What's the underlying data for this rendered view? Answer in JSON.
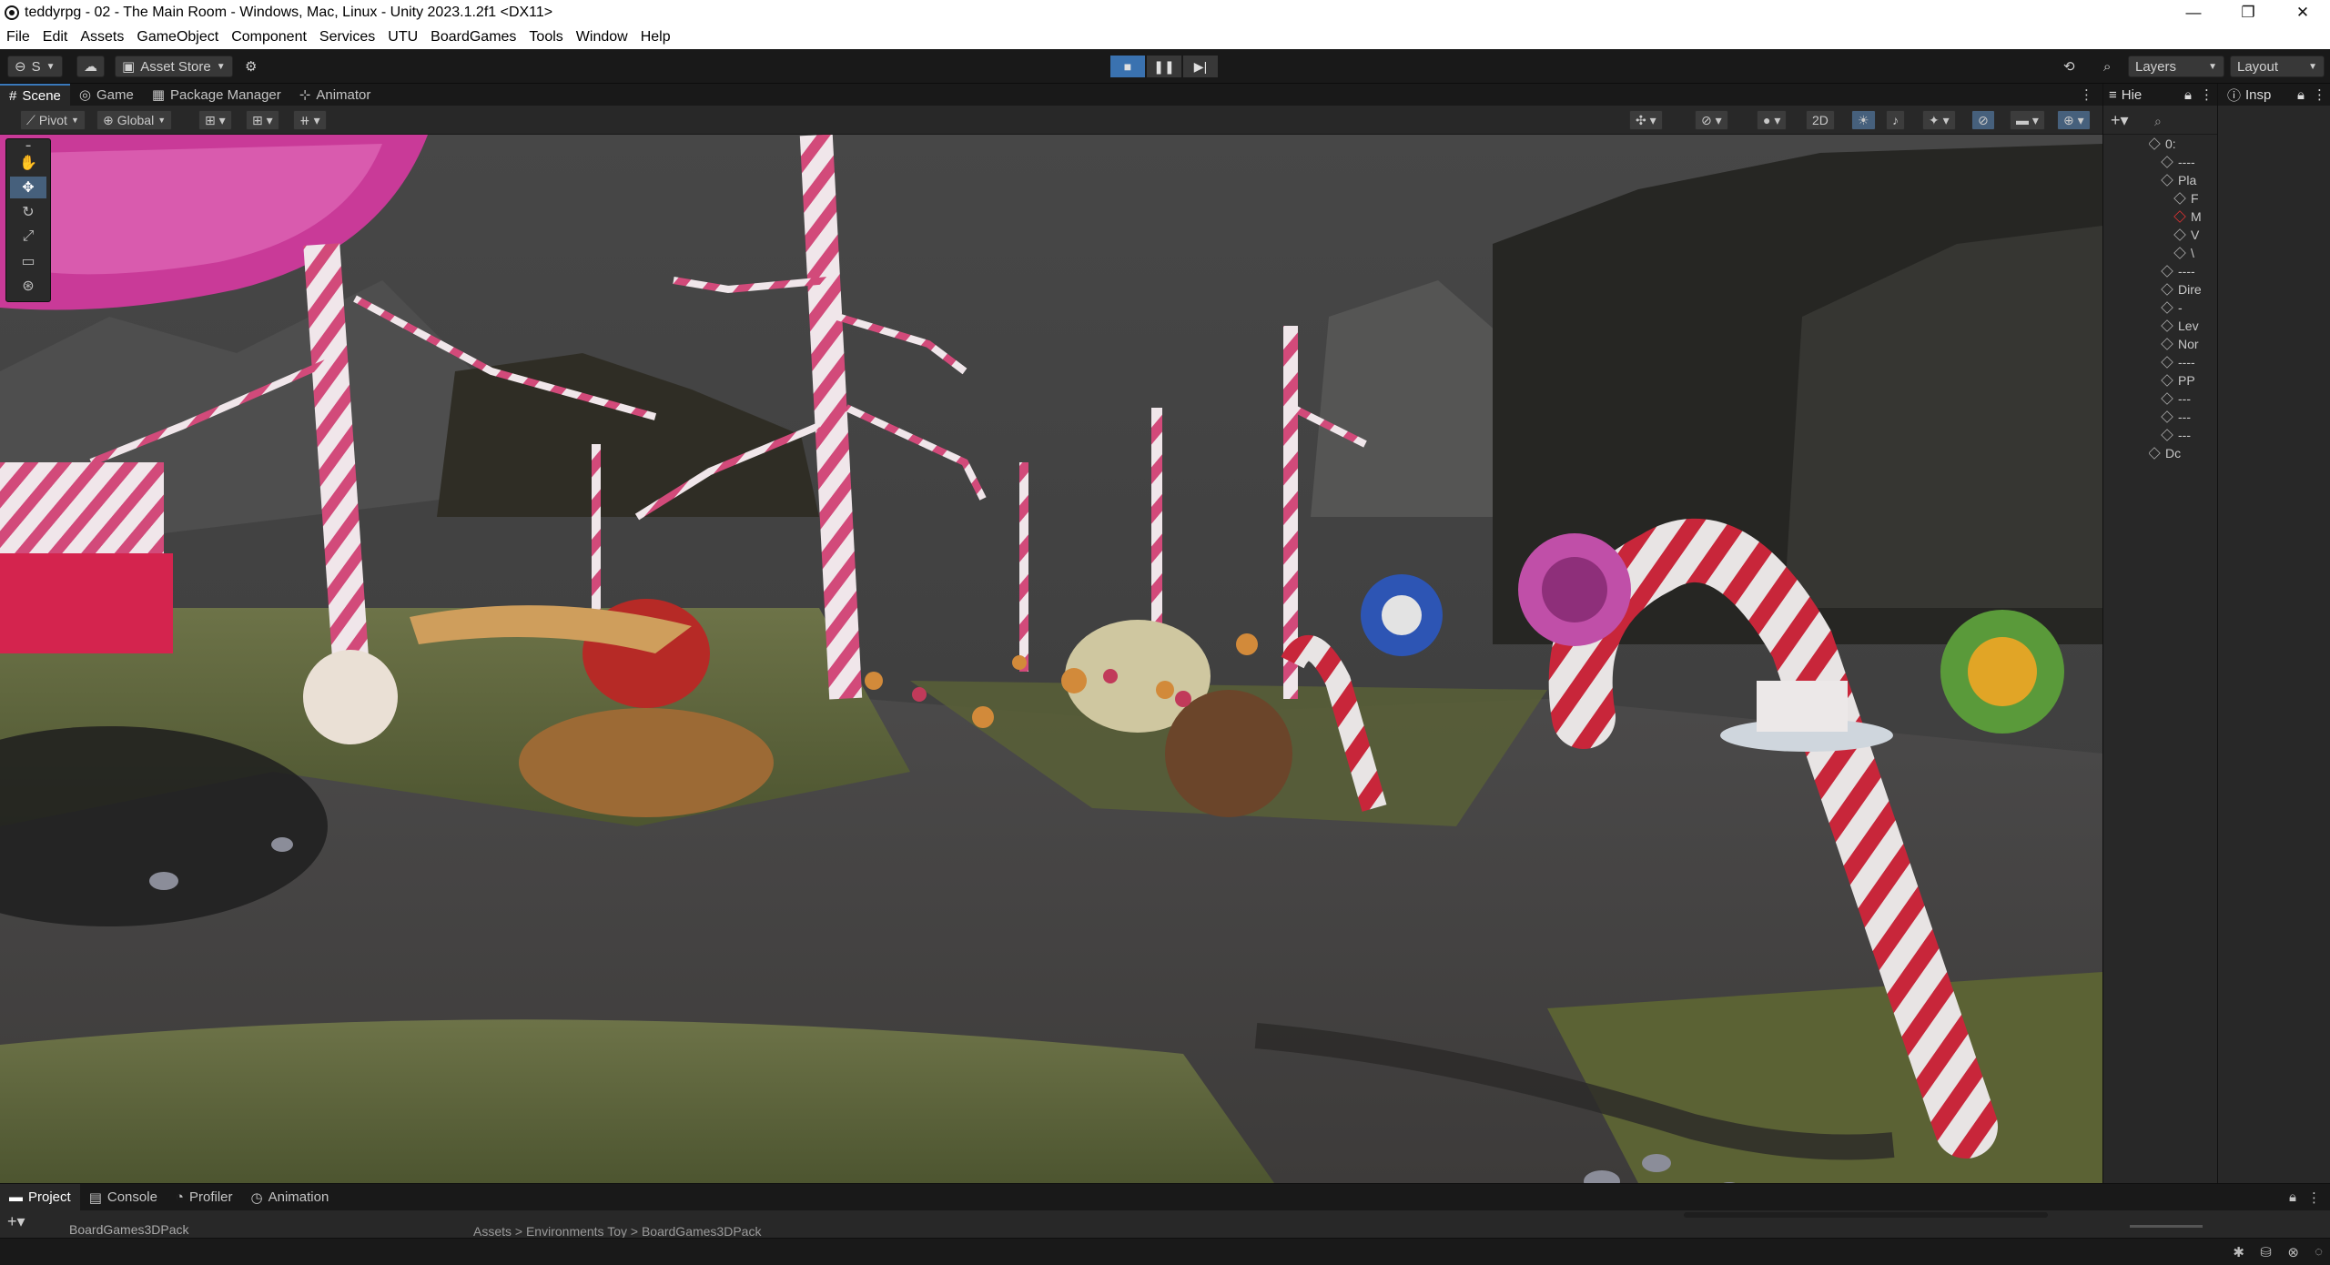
{
  "window": {
    "title": "teddyrpg - 02 - The Main Room - Windows, Mac, Linux - Unity 2023.1.2f1 <DX11>",
    "minimize": "—",
    "maximize": "❐",
    "close": "✕"
  },
  "menu": [
    "File",
    "Edit",
    "Assets",
    "GameObject",
    "Component",
    "Services",
    "UTU",
    "BoardGames",
    "Tools",
    "Window",
    "Help"
  ],
  "toolbar": {
    "account_label": "S",
    "asset_store_label": "Asset Store",
    "layers_label": "Layers",
    "layout_label": "Layout"
  },
  "tabs": [
    {
      "label": "Scene",
      "icon": "grid-icon"
    },
    {
      "label": "Game",
      "icon": "gamepad-icon"
    },
    {
      "label": "Package Manager",
      "icon": "package-icon"
    },
    {
      "label": "Animator",
      "icon": "animator-icon"
    }
  ],
  "scene_toolbar": {
    "pivot_label": "Pivot",
    "global_label": "Global",
    "mode_2d_label": "2D"
  },
  "hierarchy": {
    "tab_label": "Hie",
    "rows": [
      "0:",
      "----",
      "Pla",
      "F",
      "M",
      "V",
      "\\",
      "----",
      "Dire",
      "-",
      "Lev",
      "Nor",
      "----",
      "PP",
      "---",
      "---",
      "---",
      "Dc"
    ]
  },
  "inspector": {
    "tab_label": "Insp"
  },
  "bottom_tabs": [
    {
      "label": "Project",
      "icon": "folder-icon"
    },
    {
      "label": "Console",
      "icon": "console-icon"
    },
    {
      "label": "Profiler",
      "icon": "profiler-icon"
    },
    {
      "label": "Animation",
      "icon": "clock-icon"
    }
  ],
  "project": {
    "folder_label": "BoardGames3DPack",
    "breadcrumb": "Assets > Environments Toy > BoardGames3DPack"
  },
  "colors": {
    "play_active": "#3a72b0",
    "tab_highlight": "#3a79bb"
  }
}
